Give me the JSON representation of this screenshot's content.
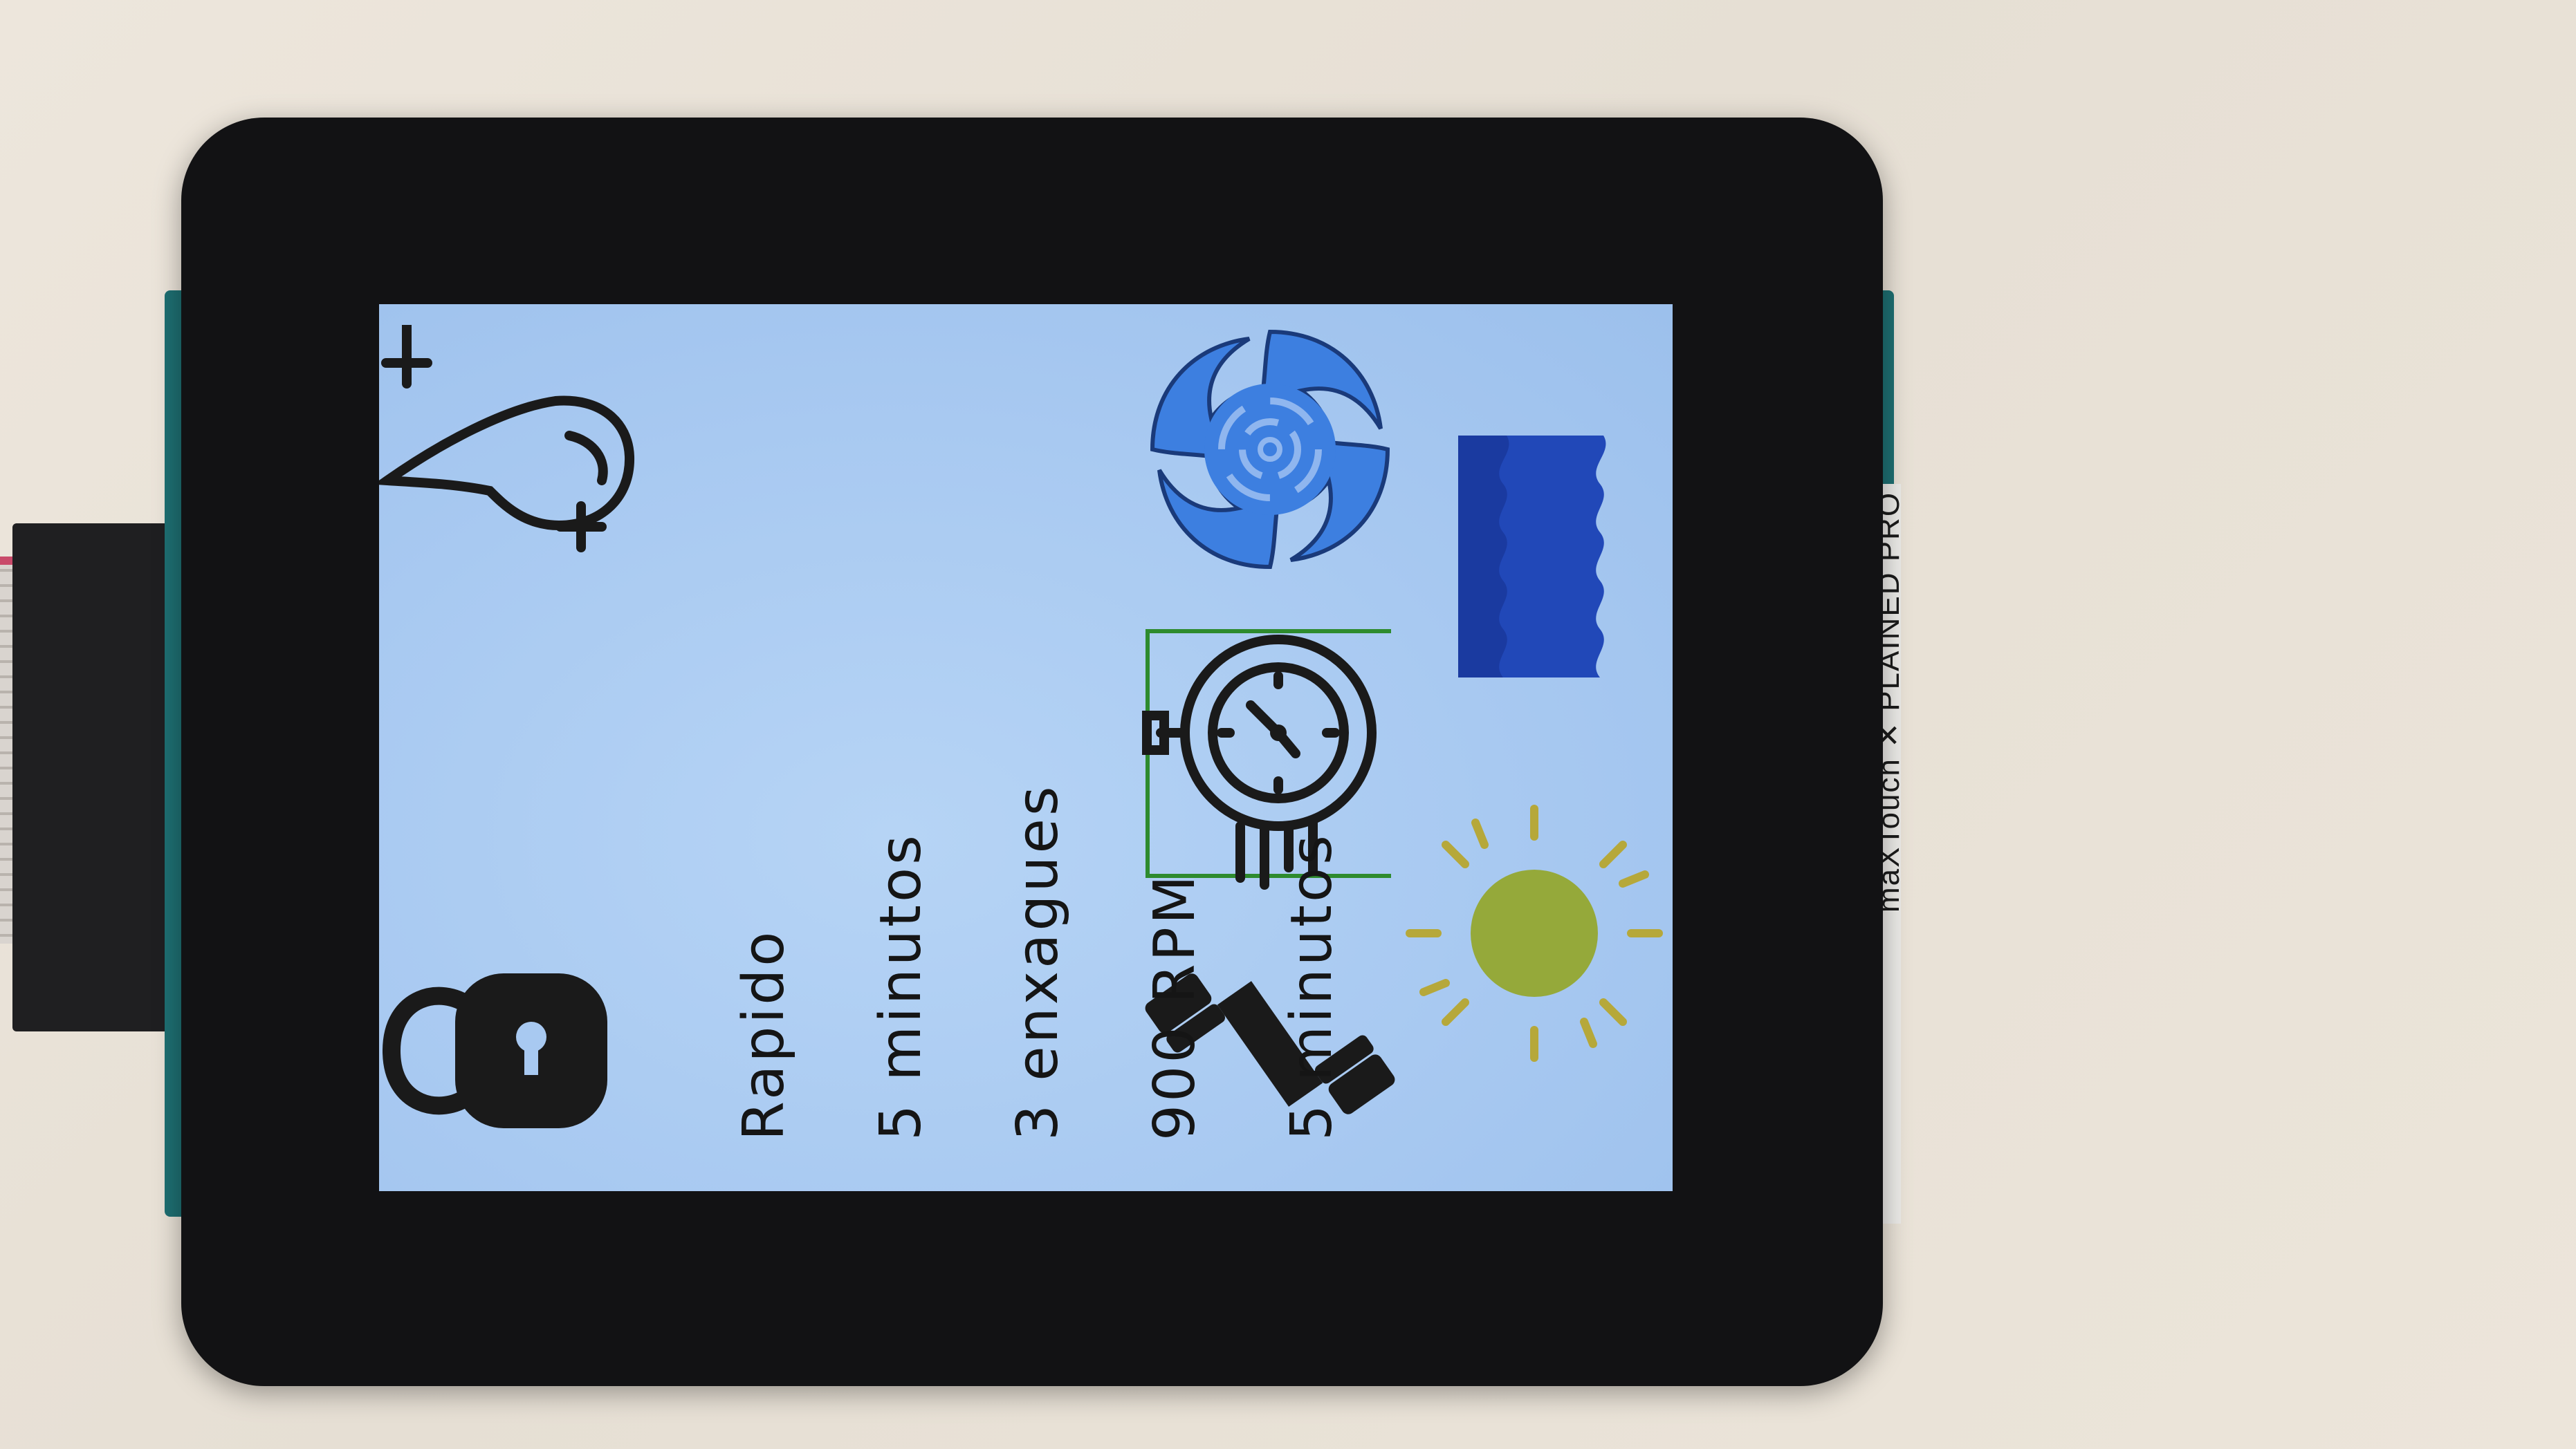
{
  "device": {
    "brand_label": "maXTouch ✕ PLAINED PRO"
  },
  "screen": {
    "program_name": "Rapido",
    "wash_time": "5 minutos",
    "rinses": "3 enxagues",
    "spin_speed": "900 RPM",
    "dry_time": "5 minutos"
  },
  "icons": [
    "water-drop-plus-icon",
    "spin-vortex-icon",
    "water-level-icon",
    "stopwatch-icon",
    "sun-icon",
    "unlock-icon",
    "heavy-duty-dumbbell-icon"
  ],
  "colors": {
    "screen_bg": "#a8c9f1",
    "vortex_blue": "#3d7fe0",
    "water_blue": "#2148b8",
    "sun_fill": "#95a93a",
    "sun_rays": "#b6a83a",
    "selection_border": "#2e8b2e"
  }
}
